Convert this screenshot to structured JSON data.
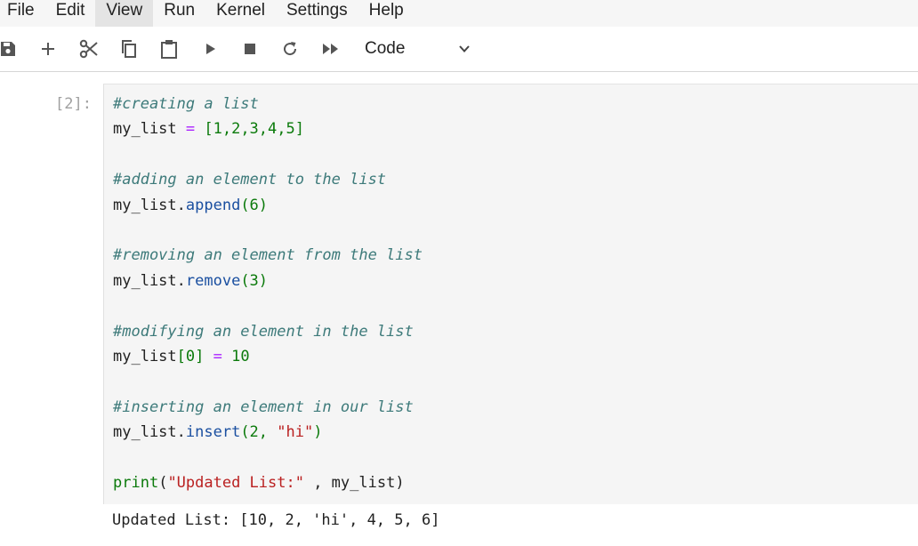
{
  "menubar": {
    "items": [
      {
        "label": "File"
      },
      {
        "label": "Edit"
      },
      {
        "label": "View"
      },
      {
        "label": "Run"
      },
      {
        "label": "Kernel"
      },
      {
        "label": "Settings"
      },
      {
        "label": "Help"
      }
    ],
    "active_item": "View"
  },
  "toolbar": {
    "buttons": [
      {
        "icon": "save-icon"
      },
      {
        "icon": "plus-icon"
      },
      {
        "icon": "cut-icon"
      },
      {
        "icon": "copy-icon"
      },
      {
        "icon": "paste-icon"
      },
      {
        "icon": "run-icon"
      },
      {
        "icon": "stop-icon"
      },
      {
        "icon": "restart-icon"
      },
      {
        "icon": "fast-forward-icon"
      }
    ],
    "cell_type": "Code"
  },
  "cell": {
    "prompt": "[2]:",
    "code": {
      "c1": "#creating a list",
      "l1_var": "my_list",
      "l1_op": " = ",
      "l1_val": "[1,2,3,4,5]",
      "c2": "#adding an element to the list",
      "l2_var": "my_list.",
      "l2_fn": "append",
      "l2_args": "(6)",
      "c3": "#removing an element from the list",
      "l3_var": "my_list.",
      "l3_fn": "remove",
      "l3_args": "(3)",
      "c4": "#modifying an element in the list",
      "l4_var": "my_list",
      "l4_idx": "[0]",
      "l4_op": " = ",
      "l4_val": "10",
      "c5": "#inserting an element in our list",
      "l5_var": "my_list.",
      "l5_fn": "insert",
      "l5_args_open": "(2, ",
      "l5_str": "\"hi\"",
      "l5_args_close": ")",
      "l6_fn": "print",
      "l6_open": "(",
      "l6_str": "\"Updated List:\"",
      "l6_rest": " , my_list)"
    },
    "output": "Updated List: [10, 2, 'hi', 4, 5, 6]"
  },
  "colors": {
    "comment": "#3d7a7a",
    "operator": "#aa22ff",
    "number": "#0b7a0b",
    "function": "#1a4fa0",
    "string": "#ba2121"
  }
}
